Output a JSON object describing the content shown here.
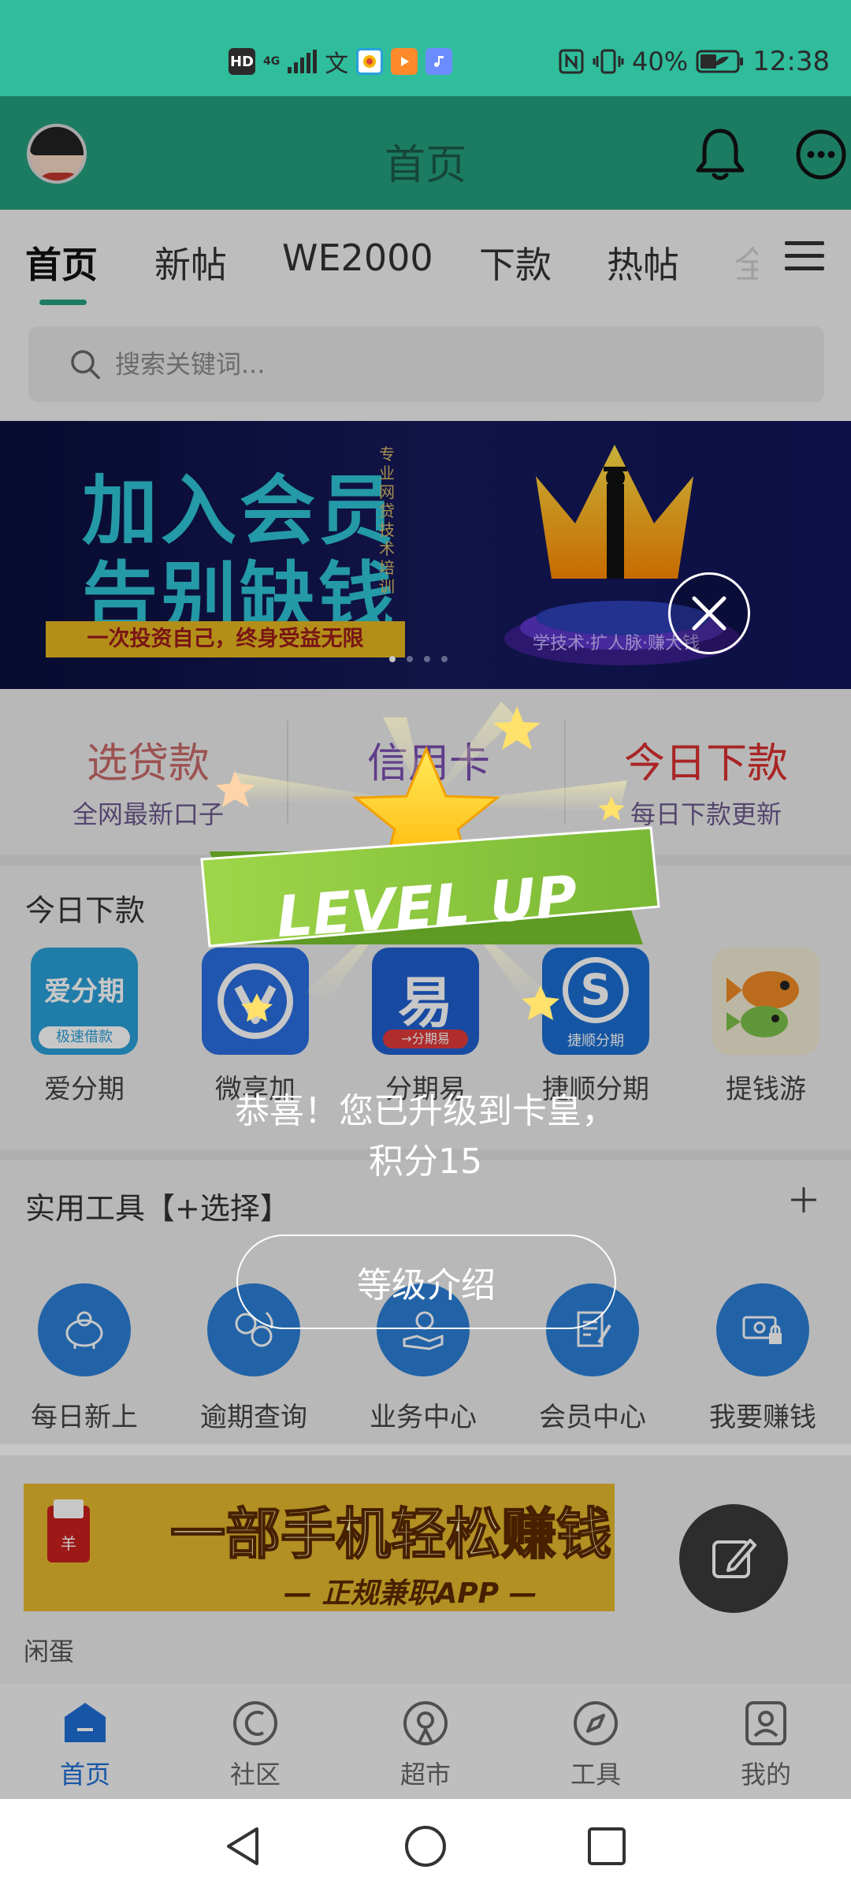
{
  "status_bar": {
    "network_hd": "HD",
    "network_gen": "4G",
    "battery_percent": "40%",
    "time": "12:38",
    "icons": [
      "hd-icon",
      "signal-icon",
      "wen-icon",
      "browser-app-icon",
      "video-app-icon",
      "music-app-icon",
      "nfc-icon",
      "vibrate-icon",
      "battery-icon"
    ]
  },
  "header": {
    "title": "首页",
    "icons": [
      "avatar",
      "bell-icon",
      "more-icon"
    ]
  },
  "tabs": [
    {
      "label": "首页",
      "active": true
    },
    {
      "label": "新帖"
    },
    {
      "label": "WE2000"
    },
    {
      "label": "下款"
    },
    {
      "label": "热帖"
    },
    {
      "label": "全"
    }
  ],
  "search": {
    "placeholder": "搜索关键词..."
  },
  "banner": {
    "line1": "加入会员",
    "line2": "告别缺钱",
    "vertical_text": "专业网贷技术培训",
    "strip": "一次投资自己，终身受益无限",
    "pedestal_text": "学技术·扩人脉·赚大钱",
    "slide_count": 4,
    "active_slide": 1
  },
  "quick_links": [
    {
      "title": "选贷款",
      "subtitle": "全网最新口子",
      "color": "#c86a6a"
    },
    {
      "title": "信用卡",
      "subtitle": "",
      "color": "#7a4fb0"
    },
    {
      "title": "今日下款",
      "subtitle": "每日下款更新",
      "color": "#d93030"
    }
  ],
  "today_loans": {
    "title": "今日下款",
    "apps": [
      {
        "name": "爱分期",
        "icon_text": "爱分期",
        "icon_sub": "极速借款"
      },
      {
        "name": "微享加",
        "icon_text": "V"
      },
      {
        "name": "分期易",
        "icon_text": "易",
        "icon_sub": "→分期易"
      },
      {
        "name": "捷顺分期",
        "icon_text": "S",
        "icon_sub": "捷顺分期"
      },
      {
        "name": "提钱游",
        "icon_text": ""
      }
    ]
  },
  "tools": {
    "title": "实用工具【+选择】",
    "items": [
      {
        "label": "每日新上",
        "icon": "piggy-bank-icon"
      },
      {
        "label": "逾期查询",
        "icon": "currency-exchange-icon"
      },
      {
        "label": "业务中心",
        "icon": "money-hand-icon"
      },
      {
        "label": "会员中心",
        "icon": "document-pen-icon"
      },
      {
        "label": "我要赚钱",
        "icon": "cash-lock-icon"
      }
    ]
  },
  "ad": {
    "text": "一部手机轻松赚钱",
    "sub": "— 正规兼职APP —",
    "envelope_char": "羊",
    "caption": "闲蛋"
  },
  "bottom_nav": [
    {
      "label": "首页",
      "active": true,
      "icon": "home-icon"
    },
    {
      "label": "社区",
      "icon": "community-icon"
    },
    {
      "label": "超市",
      "icon": "market-icon"
    },
    {
      "label": "工具",
      "icon": "compass-icon"
    },
    {
      "label": "我的",
      "icon": "profile-icon"
    }
  ],
  "popup": {
    "badge_text": "LEVEL UP",
    "message": "恭喜！您已升级到卡皇，积分15",
    "button_label": "等级介绍"
  },
  "colors": {
    "status_bar": "#2fbd9c",
    "header": "#249f7e",
    "accent_blue": "#1e6fd6",
    "tool_blue": "#2c7fd6",
    "levelup_green": "#8cc63f",
    "star_yellow": "#ffd629"
  }
}
